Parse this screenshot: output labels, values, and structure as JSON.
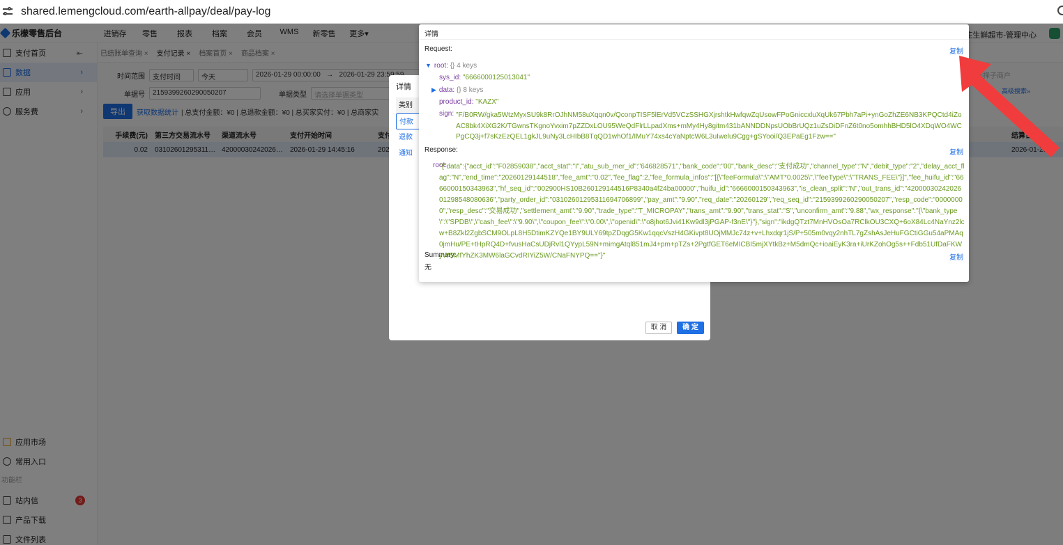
{
  "browser": {
    "url": "shared.lemengcloud.com/earth-allpay/deal/pay-log"
  },
  "app": {
    "logo": "乐檬零售后台",
    "nav": [
      "进销存",
      "零售",
      "报表",
      "档案",
      "会员",
      "WMS",
      "新零售",
      "更多▾"
    ],
    "store": "祥庄生鲜超市-管理中心"
  },
  "sidebar": {
    "collapse_glyph": "⇤",
    "items": [
      {
        "label": "支付首页"
      },
      {
        "label": "数据"
      },
      {
        "label": "应用"
      },
      {
        "label": "服务费"
      }
    ],
    "bottom": [
      {
        "label": "应用市场"
      },
      {
        "label": "常用入口"
      }
    ],
    "section_label": "功能栏",
    "tools": [
      {
        "label": "站内信",
        "badge": "3"
      },
      {
        "label": "产品下载"
      },
      {
        "label": "文件列表"
      }
    ]
  },
  "tabs": [
    {
      "label": "已结账单查询 ×"
    },
    {
      "label": "支付记录 ×"
    },
    {
      "label": "档案首页 ×"
    },
    {
      "label": "商品档案 ×"
    }
  ],
  "filters": {
    "time_label": "时间范围",
    "time_type": "支付时间",
    "time_preset": "今天",
    "start": "2026-01-29 00:00:00",
    "arrow": "→",
    "end": "2026-01-29 23:59:59",
    "order_label": "单据号",
    "order_value": "2159399260290050207",
    "type_label": "单据类型",
    "type_placeholder": "请选择单据类型",
    "merchant_placeholder": "请选择子商户",
    "advanced": "高级搜索»"
  },
  "actions": {
    "export": "导出",
    "stats_link": "获取数据统计",
    "summary": "| 总支付金额：¥0 | 总退款金额：¥0 | 总买家实付：¥0 | 总商家实"
  },
  "table": {
    "headers": [
      "手续费(元)",
      "第三方交易流水号",
      "渠道流水号",
      "支付开始时间",
      "支付",
      "结算日期"
    ],
    "row": [
      "0.02",
      "03102601295311…",
      "42000030242026…",
      "2026-01-29 14:45:16",
      "202",
      "2026-01-29"
    ]
  },
  "back_modal": {
    "title": "详情",
    "categories": [
      "类别",
      "付款",
      "退款",
      "通知"
    ],
    "cancel": "取 消",
    "ok": "确 定"
  },
  "detail": {
    "title": "详情",
    "request_label": "Request:",
    "copy": "复制",
    "root_key": "root:",
    "root_meta": "{}  4 keys",
    "sys_id_key": "sys_id:",
    "sys_id_val": "\"6666000125013041\"",
    "data_key": "data:",
    "data_meta": "{}  8 keys",
    "product_id_key": "product_id:",
    "product_id_val": "\"KAZX\"",
    "sign_key": "sign:",
    "sign_val": "\"F/B0RW/gka5WtzMyxSU9k8RrOJhNM58uXqqn0v/QconpTISF5lErVd5VCzSSHGXjrshtkHwfqwZqUsowFPoGniccxluXqUk67Pbh7aPi+ynGoZhZE6NB3KPQCtd4iZoAC8bk4XiXG2K/TGwnsTKgnoYvxim7pZZDxLOU95WeQdFlrLLpadXms+mMy4Hy8gitm431bANNDDNpsUObBrUQz1uZsDiDFnZ6t0no5omhhBHD5lO4XDqWO4WCPgCQ3j+f7sKzEzQEL1gkJL9uNy3LcHIbB8TqQD1whOf1/IMuY74xs4cYaNptcW6L3uIwelu9Cgg+gSYooi/Q3EPaEg1Fzw==\"",
    "response_label": "Response:",
    "resp_key": "root:",
    "resp_val": "\"{\"data\":{\"acct_id\":\"F02859038\",\"acct_stat\":\"I\",\"atu_sub_mer_id\":\"646828571\",\"bank_code\":\"00\",\"bank_desc\":\"支付成功\",\"channel_type\":\"N\",\"debit_type\":\"2\",\"delay_acct_flag\":\"N\",\"end_time\":\"20260129144518\",\"fee_amt\":\"0.02\",\"fee_flag\":2,\"fee_formula_infos\":\"[{\\\"feeFormula\\\":\\\"AMT*0.0025\\\",\\\"feeType\\\":\\\"TRANS_FEE\\\"}]\",\"fee_huifu_id\":\"6666000150343963\",\"hf_seq_id\":\"002900HS10B260129144516P8340a4f24ba00000\",\"huifu_id\":\"6666000150343963\",\"is_clean_split\":\"N\",\"out_trans_id\":\"4200003024202601298548080636\",\"party_order_id\":\"03102601295311694706899\",\"pay_amt\":\"9.90\",\"req_date\":\"20260129\",\"req_seq_id\":\"2159399260290050207\",\"resp_code\":\"00000000\",\"resp_desc\":\"交易成功\",\"settlement_amt\":\"9.90\",\"trade_type\":\"T_MICROPAY\",\"trans_amt\":\"9.90\",\"trans_stat\":\"S\",\"unconfirm_amt\":\"9.88\",\"wx_response\":\"{\\\"bank_type\\\":\\\"SPDB\\\",\\\"cash_fee\\\":\\\"9.90\\\",\\\"coupon_fee\\\":\\\"0.00\\\",\\\"openid\\\":\\\"o8jhot6Jvi41Kw9dl3jPGAP-f3nE\\\"}\"},\"sign\":\"ikdgQTzt7MnHVOsOa7RClkOU3CXQ+6oX84Lc4NaYnz2lcw+B8Zkl2ZgbSCM9OLpL8H5DtimKZYQe1BY9ULY69tpZDqgG5Kw1qqcVszH4GKivpt8UOjMMJc74z+v+Lhxdqr1jS/P+505m0vqy2nhTL7gZshAsJeHuFGCtiGGu54aPMAq0jmHu/PE+tHpRQ4D+fvusHaCsUDjRvl1QYypL59N+mimgAtql851mJ4+pm+pTZs+2PgtfGET6eMICBI5mjXYtkBz+M5dmQc+ioaiEyK3ra+iUrKZohOg5s++Fdb51UfDaFKWyWSMfYhZK3MW6laGCvdRIYiZ5W/CNaFNYPQ==\"}\"",
    "summary_label": "Summary:",
    "summary_val": "无"
  },
  "colors": {
    "accent": "#1f6fe5",
    "json_string": "#6a9a1f",
    "json_key": "#7b3fa0",
    "arrow": "#f03c3c"
  }
}
